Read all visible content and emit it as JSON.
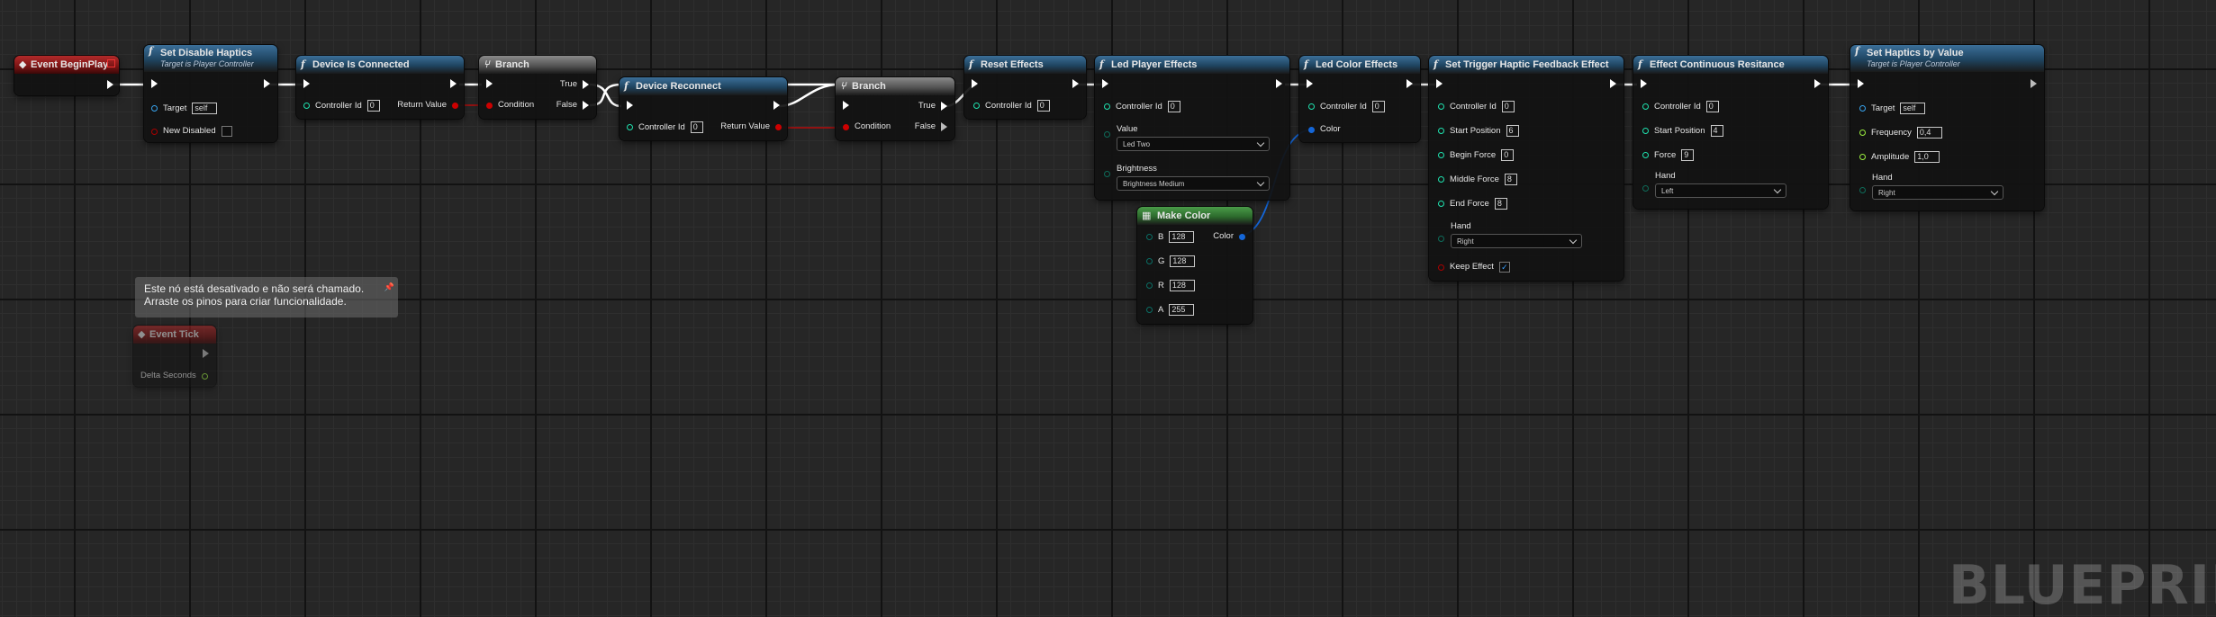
{
  "watermark": "BLUEPRINT",
  "comment": "Este nó está desativado e não será chamado.\nArraste os pinos para criar funcionalidade.",
  "nodes": {
    "begin_play": {
      "title": "Event BeginPlay"
    },
    "set_disable_haptics": {
      "title": "Set Disable Haptics",
      "subtitle": "Target is Player Controller",
      "target_label": "Target",
      "target_value": "self",
      "new_disabled_label": "New Disabled"
    },
    "device_connected": {
      "title": "Device Is Connected",
      "controller_label": "Controller Id",
      "controller_value": "0",
      "return_label": "Return Value"
    },
    "branch1": {
      "title": "Branch",
      "condition": "Condition",
      "true_label": "True",
      "false_label": "False"
    },
    "device_reconnect": {
      "title": "Device Reconnect",
      "controller_label": "Controller Id",
      "controller_value": "0",
      "return_label": "Return Value"
    },
    "branch2": {
      "title": "Branch",
      "condition": "Condition",
      "true_label": "True",
      "false_label": "False"
    },
    "reset_effects": {
      "title": "Reset Effects",
      "controller_label": "Controller Id",
      "controller_value": "0"
    },
    "led_player": {
      "title": "Led Player Effects",
      "controller_label": "Controller Id",
      "controller_value": "0",
      "value_label": "Value",
      "value_option": "Led Two",
      "brightness_label": "Brightness",
      "brightness_option": "Brightness Medium"
    },
    "led_color": {
      "title": "Led Color Effects",
      "controller_label": "Controller Id",
      "controller_value": "0",
      "color_label": "Color"
    },
    "make_color": {
      "title": "Make Color",
      "b_label": "B",
      "b_value": "128",
      "g_label": "G",
      "g_value": "128",
      "r_label": "R",
      "r_value": "128",
      "a_label": "A",
      "a_value": "255",
      "out_label": "Color"
    },
    "trigger_haptic": {
      "title": "Set Trigger Haptic Feedback Effect",
      "controller_label": "Controller Id",
      "controller_value": "0",
      "start_label": "Start Position",
      "start_value": "6",
      "begin_label": "Begin Force",
      "begin_value": "0",
      "middle_label": "Middle Force",
      "middle_value": "8",
      "end_label": "End Force",
      "end_value": "8",
      "hand_label": "Hand",
      "hand_option": "Right",
      "keep_label": "Keep Effect",
      "keep_value": "✓"
    },
    "effect_resistance": {
      "title": "Effect Continuous Resitance",
      "controller_label": "Controller Id",
      "controller_value": "0",
      "start_label": "Start Position",
      "start_value": "4",
      "force_label": "Force",
      "force_value": "9",
      "hand_label": "Hand",
      "hand_option": "Left"
    },
    "set_haptics_value": {
      "title": "Set Haptics by Value",
      "subtitle": "Target is Player Controller",
      "target_label": "Target",
      "target_value": "self",
      "freq_label": "Frequency",
      "freq_value": "0,4",
      "amp_label": "Amplitude",
      "amp_value": "1,0",
      "hand_label": "Hand",
      "hand_option": "Right"
    },
    "event_tick": {
      "title": "Event Tick",
      "delta_label": "Delta Seconds"
    }
  }
}
